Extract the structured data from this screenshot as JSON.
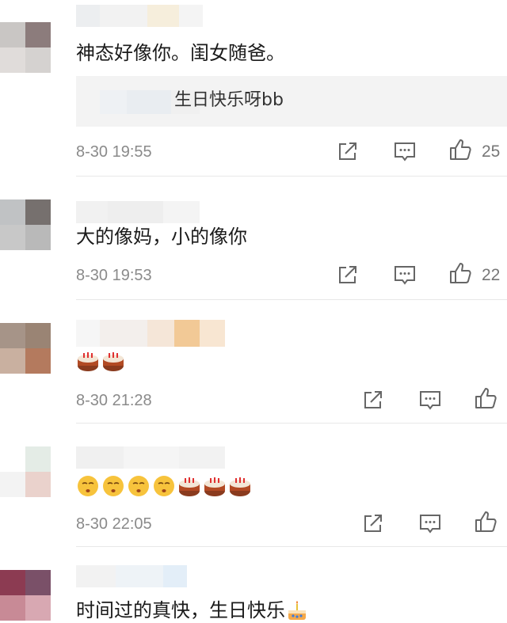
{
  "comments": [
    {
      "text": "神态好像你。闺女随爸。",
      "reply": "生日快乐呀bb",
      "time": "8-30 19:55",
      "likes": "25"
    },
    {
      "text": "大的像妈，小的像你",
      "time": "8-30 19:53",
      "likes": "22"
    },
    {
      "emojis": [
        "cake-emoji",
        "cake-emoji"
      ],
      "time": "8-30 21:28",
      "likes": ""
    },
    {
      "emojis": [
        "blowing-kiss-face-emoji",
        "blowing-kiss-face-emoji",
        "blowing-kiss-face-emoji",
        "blowing-kiss-face-emoji",
        "cake-emoji",
        "cake-emoji",
        "cake-emoji"
      ],
      "time": "8-30 22:05",
      "likes": ""
    },
    {
      "text": "时间过的真快，生日快乐",
      "emojis": [
        "birthday-cake-emoji"
      ]
    }
  ],
  "icons": {
    "share": "share-icon",
    "reply": "comment-icon",
    "like": "thumbs-up-icon"
  }
}
